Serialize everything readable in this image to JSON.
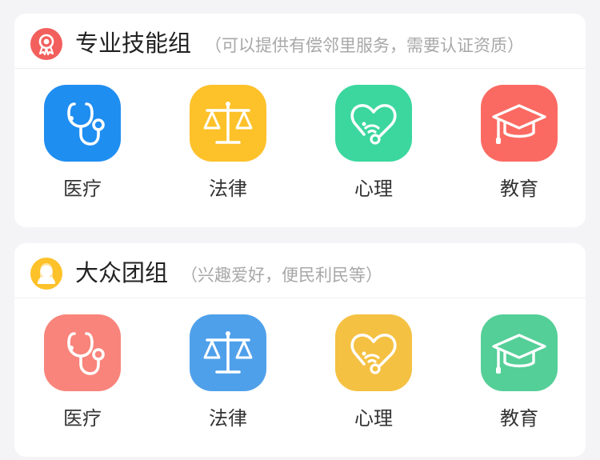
{
  "sections": [
    {
      "title": "专业技能组",
      "subtitle": "（可以提供有偿邻里服务，需要认证资质）",
      "badge_icon": "award-ribbon-icon",
      "badge_color": "#f25f5c",
      "items": [
        {
          "label": "医疗",
          "icon": "stethoscope-icon",
          "color": "#1f8ef1"
        },
        {
          "label": "法律",
          "icon": "scales-icon",
          "color": "#fdc12a"
        },
        {
          "label": "心理",
          "icon": "heart-signal-icon",
          "color": "#3bd79e"
        },
        {
          "label": "教育",
          "icon": "graduation-cap-icon",
          "color": "#fb6a62"
        }
      ]
    },
    {
      "title": "大众团组",
      "subtitle": "（兴趣爱好，便民利民等）",
      "badge_icon": "person-avatar-icon",
      "badge_color": "#fdc12a",
      "items": [
        {
          "label": "医疗",
          "icon": "stethoscope-icon",
          "color": "#f8847b"
        },
        {
          "label": "法律",
          "icon": "scales-icon",
          "color": "#4fa0ea"
        },
        {
          "label": "心理",
          "icon": "heart-signal-icon",
          "color": "#f5c143"
        },
        {
          "label": "教育",
          "icon": "graduation-cap-icon",
          "color": "#54cf98"
        }
      ]
    }
  ]
}
